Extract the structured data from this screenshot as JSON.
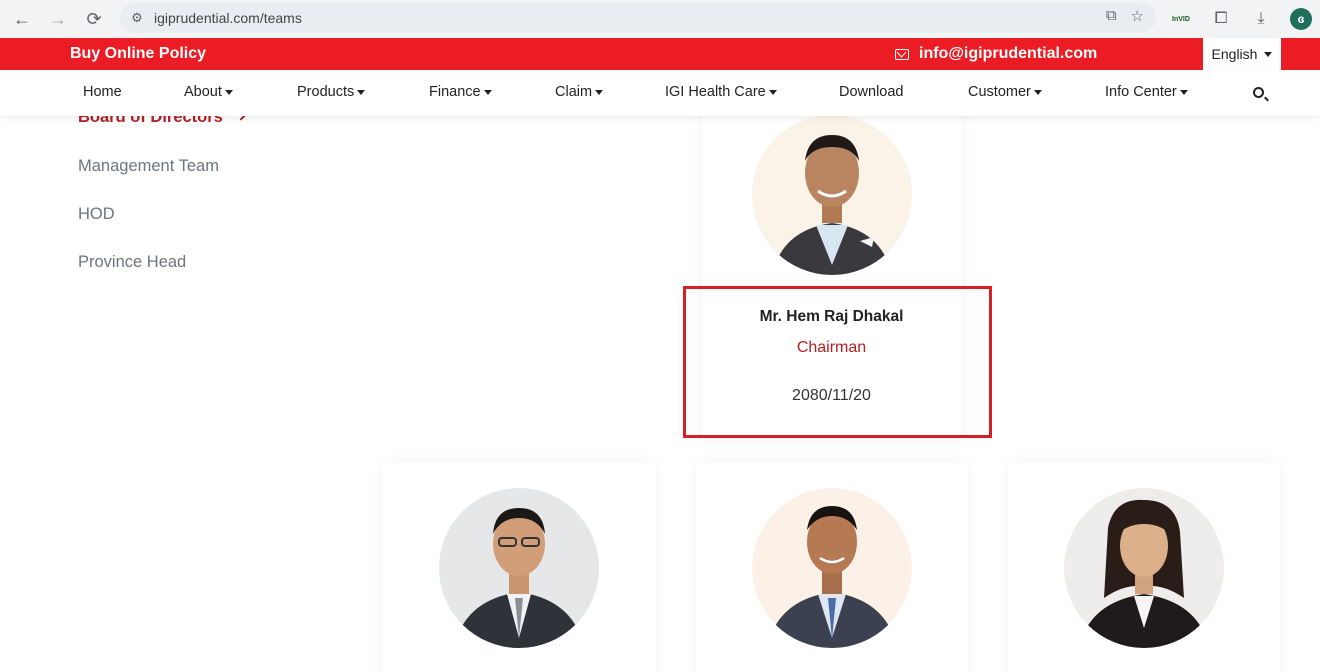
{
  "browser": {
    "url": "igiprudential.com/teams",
    "ext_invid_label": "InVID"
  },
  "top_strip": {
    "buy_label": "Buy Online Policy",
    "email": "info@igiprudential.com",
    "language": "English"
  },
  "nav": {
    "items": [
      "Home",
      "About",
      "Products",
      "Finance",
      "Claim",
      "IGI Health Care",
      "Download",
      "Customer",
      "Info Center"
    ]
  },
  "sidebar": {
    "items": [
      "Board of Directors",
      "Management Team",
      "HOD",
      "Province Head"
    ],
    "active_index": 0
  },
  "featured_member": {
    "name": "Mr. Hem Raj Dhakal",
    "role": "Chairman",
    "date": "2080/11/20"
  },
  "colors": {
    "brand_red": "#ec1c24",
    "accent_dark_red": "#b52025"
  }
}
